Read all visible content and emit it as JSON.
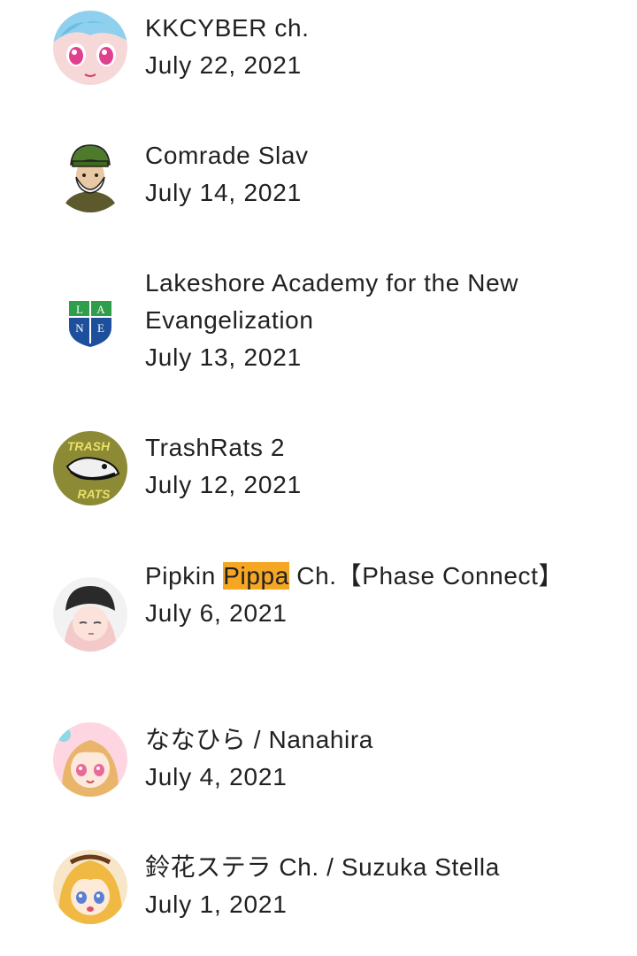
{
  "channels": [
    {
      "name": "KKCYBER ch.",
      "date": "July 22, 2021",
      "avatar_icon": "anime-girl-avatar"
    },
    {
      "name": "Comrade Slav",
      "date": "July 14, 2021",
      "avatar_icon": "bearded-man-ushanka-avatar"
    },
    {
      "name": "Lakeshore Academy for the New Evangelization",
      "date": "July 13, 2021",
      "avatar_icon": "lane-shield-logo"
    },
    {
      "name": "TrashRats 2",
      "date": "July 12, 2021",
      "avatar_icon": "trashrats-logo"
    },
    {
      "name_before": "Pipkin ",
      "name_highlight": "Pippa",
      "name_after": " Ch.【Phase Connect】",
      "date": "July 6, 2021",
      "avatar_icon": "beanie-girl-avatar"
    },
    {
      "name": "ななひら / Nanahira",
      "date": "July 4, 2021",
      "avatar_icon": "anime-girl-avatar"
    },
    {
      "name": "鈴花ステラ Ch. / Suzuka Stella",
      "date": "July 1, 2021",
      "avatar_icon": "anime-girl-avatar"
    }
  ],
  "logo_text": {
    "lane": [
      "L",
      "A",
      "N",
      "E"
    ],
    "trashrats_top": "TRASH",
    "trashrats_bottom": "RATS"
  },
  "colors": {
    "highlight": "#f5a623",
    "text": "#212121"
  }
}
